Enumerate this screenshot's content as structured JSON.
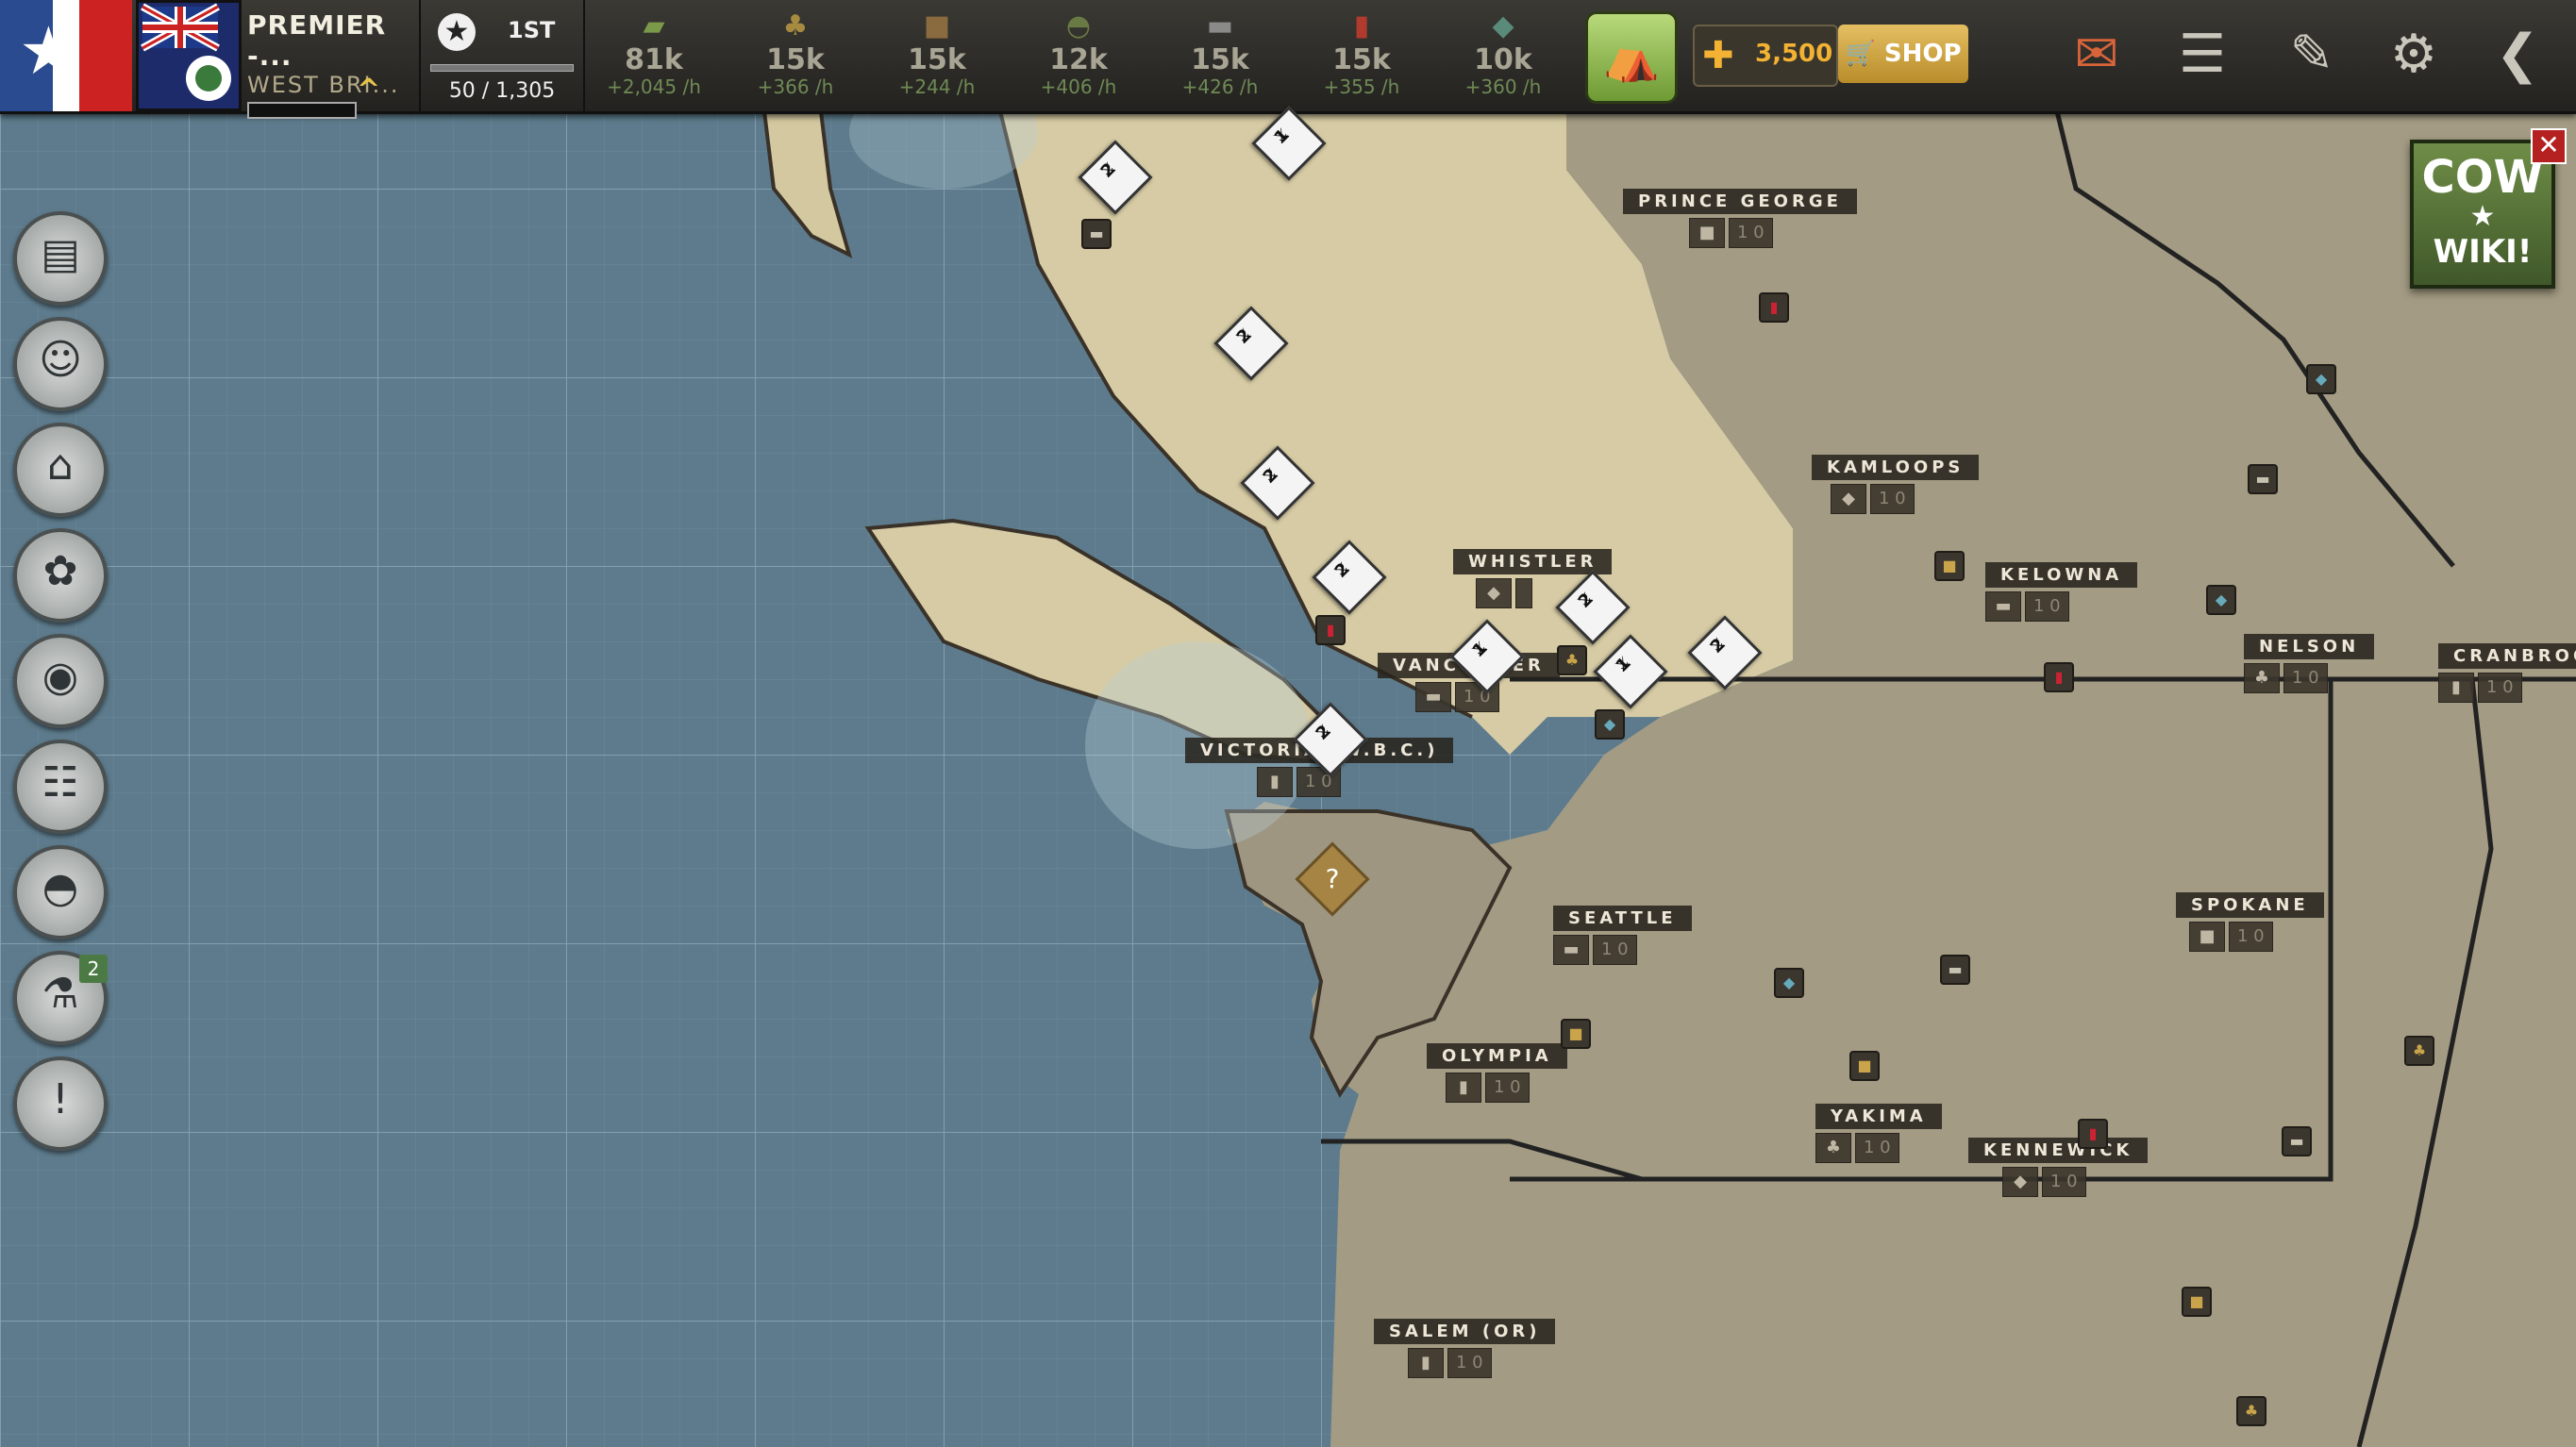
{
  "player": {
    "title": "PREMIER -...",
    "nation": "WEST BRI...",
    "rank": "1ST",
    "points": "50 / 1,305"
  },
  "resources": [
    {
      "icon": "money-icon",
      "amount": "81k",
      "rate": "+2,045 /h",
      "color": "#7a9a4a"
    },
    {
      "icon": "grain-icon",
      "amount": "15k",
      "rate": "+366 /h",
      "color": "#a58a3f"
    },
    {
      "icon": "supplies-icon",
      "amount": "15k",
      "rate": "+244 /h",
      "color": "#8a6a3f"
    },
    {
      "icon": "helmet-icon",
      "amount": "12k",
      "rate": "+406 /h",
      "color": "#6a7a44"
    },
    {
      "icon": "steel-icon",
      "amount": "15k",
      "rate": "+426 /h",
      "color": "#8a8a88"
    },
    {
      "icon": "fuel-icon",
      "amount": "15k",
      "rate": "+355 /h",
      "color": "#b03a2e"
    },
    {
      "icon": "rare-material-icon",
      "amount": "10k",
      "rate": "+360 /h",
      "color": "#5a8a7a"
    }
  ],
  "gold": "3,500",
  "shop_label": "SHOP",
  "wiki": {
    "line1": "COW",
    "line2": "★",
    "line3": "WIKI!"
  },
  "side_badge": "2",
  "cities": [
    {
      "name": "PRINCE GEORGE",
      "prod": "1 0"
    },
    {
      "name": "KAMLOOPS",
      "prod": "1 0"
    },
    {
      "name": "KELOWNA",
      "prod": "1 0"
    },
    {
      "name": "NELSON",
      "prod": "1 0"
    },
    {
      "name": "CRANBROO",
      "prod": "1 0"
    },
    {
      "name": "WHISTLER",
      "prod": ""
    },
    {
      "name": "VANCOUVER",
      "prod": "1 0"
    },
    {
      "name": "VICTORIA (W.B.C.)",
      "prod": "1 0"
    },
    {
      "name": "SEATTLE",
      "prod": "1 0"
    },
    {
      "name": "SPOKANE",
      "prod": "1 0"
    },
    {
      "name": "OLYMPIA",
      "prod": "1 0"
    },
    {
      "name": "YAKIMA",
      "prod": "1 0"
    },
    {
      "name": "KENNEWICK",
      "prod": "1 0"
    },
    {
      "name": "SALEM (OR)",
      "prod": "1 0"
    }
  ],
  "units": [
    "1",
    "2",
    "2",
    "2",
    "2",
    "2",
    "1",
    "2",
    "1",
    "2"
  ]
}
